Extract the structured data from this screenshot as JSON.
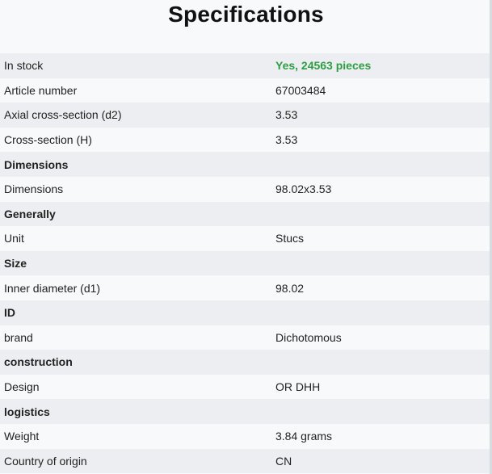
{
  "page": {
    "title": "Specifications"
  },
  "colors": {
    "stock_accent": "#2e9e45",
    "row_alt": "#eceef1",
    "row_base": "#f8f9fb"
  },
  "specs": {
    "in_stock_label": "In stock",
    "in_stock_value": "Yes, 24563 pieces",
    "article_number_label": "Article number",
    "article_number_value": "67003484",
    "axial_label": "Axial cross-section (d2)",
    "axial_value": "3.53",
    "cross_label": "Cross-section (H)",
    "cross_value": "3.53",
    "dimensions_section": "Dimensions",
    "dimensions_label": "Dimensions",
    "dimensions_value": "98.02x3.53",
    "generally_section": "Generally",
    "unit_label": "Unit",
    "unit_value": "Stucs",
    "size_section": "Size",
    "inner_diameter_label": "Inner diameter (d1)",
    "inner_diameter_value": "98.02",
    "id_section": "ID",
    "brand_label": "brand",
    "brand_value": "Dichotomous",
    "construction_section": "construction",
    "design_label": "Design",
    "design_value": "OR DHH",
    "logistics_section": "logistics",
    "weight_label": "Weight",
    "weight_value": "3.84 grams",
    "origin_label": "Country of origin",
    "origin_value": "CN"
  }
}
